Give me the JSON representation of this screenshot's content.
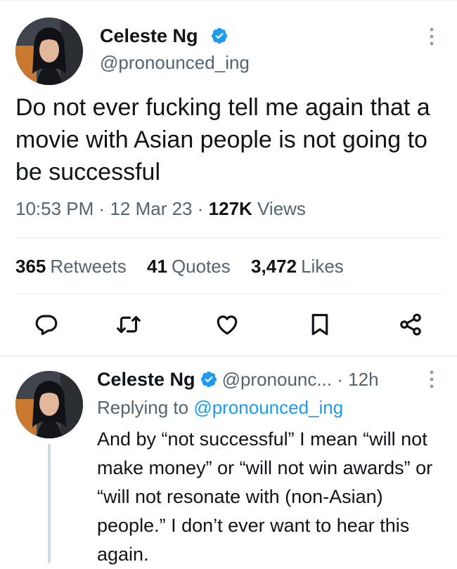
{
  "colors": {
    "text": "#0f1419",
    "secondary": "#536471",
    "link": "#1d9bf0",
    "verified": "#1d9bf0",
    "divider": "#e6ecf0"
  },
  "tweet": {
    "author_name": "Celeste Ng",
    "handle": "@pronounced_ing",
    "text": "Do not ever fucking tell me again that a movie with Asian people is not going to be successful",
    "time": "10:53 PM",
    "date": "12 Mar 23",
    "separator": "·",
    "views_count": "127K",
    "views_label": "Views",
    "stats": {
      "retweets_count": "365",
      "retweets_label": "Retweets",
      "quotes_count": "41",
      "quotes_label": "Quotes",
      "likes_count": "3,472",
      "likes_label": "Likes"
    },
    "actions": [
      "reply-icon",
      "retweet-icon",
      "like-icon",
      "bookmark-icon",
      "share-icon"
    ]
  },
  "reply": {
    "author_name": "Celeste Ng",
    "handle": "@pronounc...",
    "separator": "·",
    "time": "12h",
    "replying_prefix": "Replying to",
    "replying_handle": "@pronounced_ing",
    "text": "And by “not successful” I mean “will not make money” or “will not win awards” or “will not resonate with (non-Asian) people.”  I don’t ever want to hear this again."
  }
}
